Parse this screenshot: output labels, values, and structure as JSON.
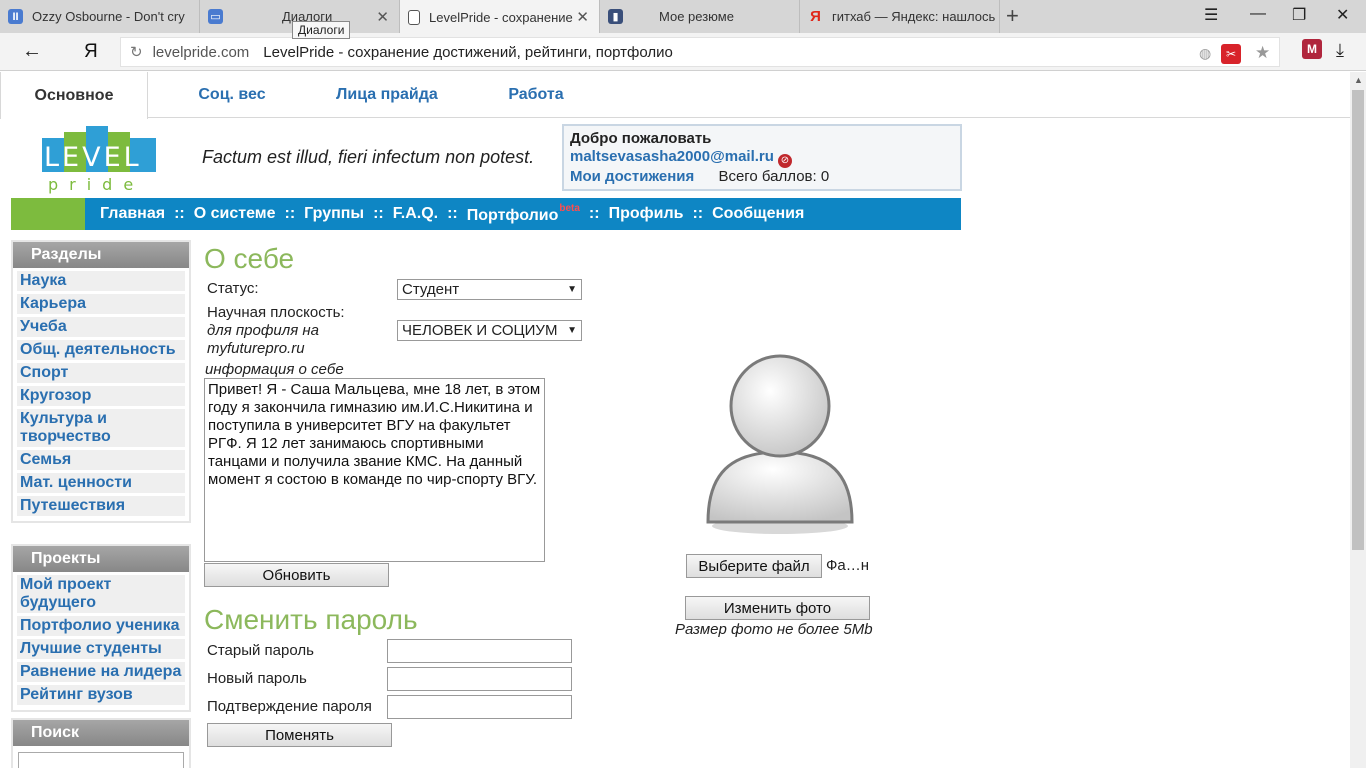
{
  "browser": {
    "tabs": [
      {
        "title": "Ozzy Osbourne - Don't cry",
        "icon": "pause-icon",
        "active": false
      },
      {
        "title": "Диалоги",
        "icon": "chat-icon",
        "active": false
      },
      {
        "title": "LevelPride - сохранение",
        "icon": "page-icon",
        "active": true
      },
      {
        "title": "Мое резюме",
        "icon": "resume-icon",
        "active": false
      },
      {
        "title": "гитхаб — Яндекс: нашлось",
        "icon": "yandex-icon",
        "active": false
      }
    ],
    "tooltip": "Диалоги",
    "back_glyph": "←",
    "yandex_glyph": "Я",
    "domain": "levelpride.com",
    "page_title": "LevelPride - сохранение достижений, рейтинги, портфолио"
  },
  "site": {
    "top_tabs": [
      "Основное",
      "Соц. вес",
      "Лица прайда",
      "Работа"
    ],
    "logo_text_top": "LEVEL",
    "logo_text_bottom": "pride",
    "motto": "Factum est illud, fieri infectum non potest.",
    "welcome": {
      "greeting": "Добро пожаловать",
      "email": "maltsevasasha2000@mail.ru",
      "achievements_link": "Мои достижения",
      "total_points": "Всего баллов: 0"
    },
    "nav": [
      {
        "label": "Главная",
        "sup": ""
      },
      {
        "label": "О системе",
        "sup": ""
      },
      {
        "label": "Группы",
        "sup": ""
      },
      {
        "label": "F.A.Q.",
        "sup": ""
      },
      {
        "label": "Портфолио",
        "sup": "beta"
      },
      {
        "label": "Профиль",
        "sup": ""
      },
      {
        "label": "Сообщения",
        "sup": ""
      }
    ],
    "nav_separator": "::"
  },
  "sidebar": {
    "sections_title": "Разделы",
    "sections": [
      "Наука",
      "Карьера",
      "Учеба",
      "Общ. деятельность",
      "Спорт",
      "Кругозор",
      "Культура и творчество",
      "Семья",
      "Мат. ценности",
      "Путешествия"
    ],
    "projects_title": "Проекты",
    "projects": [
      "Мой проект будущего",
      "Портфолио ученика",
      "Лучшие студенты",
      "Равнение на лидера",
      "Рейтинг вузов"
    ],
    "search_title": "Поиск"
  },
  "about": {
    "title": "О себе",
    "status_label": "Статус:",
    "status_value": "Студент",
    "plane_label": "Научная плоскость:",
    "plane_hint_1": "для профиля на",
    "plane_hint_2": "myfuturepro.ru",
    "plane_value": "ЧЕЛОВЕК И СОЦИУМ",
    "info_label": "информация о себе",
    "info_text": "Привет! Я - Саша Мальцева, мне 18 лет, в этом году я закончила гимназию им.И.С.Никитина и поступила в университет ВГУ на факультет РГФ. Я 12 лет занимаюсь спортивными танцами и получила звание КМС. На данный момент я состою в команде по чир-спорту ВГУ.",
    "update_button": "Обновить"
  },
  "password": {
    "title": "Сменить пароль",
    "old_label": "Старый пароль",
    "new_label": "Новый пароль",
    "confirm_label": "Подтверждение пароля",
    "change_button": "Поменять"
  },
  "photo": {
    "choose_button": "Выберите файл",
    "file_status": "Фа…н",
    "change_button": "Изменить фото",
    "note": "Размер фото не более 5Mb"
  }
}
